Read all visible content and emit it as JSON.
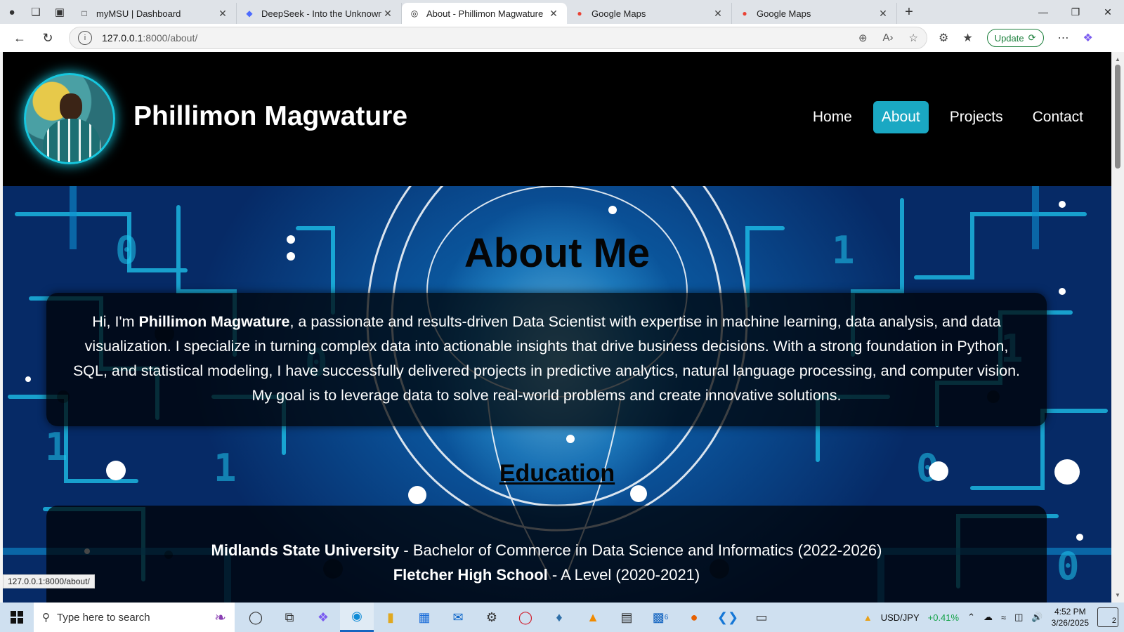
{
  "browser": {
    "tabs": [
      {
        "title": "myMSU | Dashboard",
        "icon": "page-icon",
        "active": false
      },
      {
        "title": "DeepSeek - Into the Unknown",
        "icon": "deepseek-icon",
        "active": false
      },
      {
        "title": "About - Phillimon Magwature",
        "icon": "globe-icon",
        "active": true
      },
      {
        "title": "Google Maps",
        "icon": "maps-pin-icon",
        "active": false
      },
      {
        "title": "Google Maps",
        "icon": "maps-pin-icon",
        "active": false
      }
    ],
    "address_host": "127.0.0.1",
    "address_path": ":8000/about/",
    "update_label": "Update",
    "status_url": "127.0.0.1:8000/about/"
  },
  "site": {
    "title": "Phillimon Magwature",
    "nav": [
      {
        "label": "Home",
        "active": false
      },
      {
        "label": "About",
        "active": true
      },
      {
        "label": "Projects",
        "active": false
      },
      {
        "label": "Contact",
        "active": false
      }
    ],
    "accent_color": "#1aa8c3"
  },
  "about": {
    "heading": "About Me",
    "intro_prefix": "Hi, I'm ",
    "name": "Phillimon Magwature",
    "intro_text": ", a passionate and results-driven Data Scientist with expertise in machine learning, data analysis, and data visualization. I specialize in turning complex data into actionable insights that drive business decisions. With a strong foundation in Python, SQL, and statistical modeling, I have successfully delivered projects in predictive analytics, natural language processing, and computer vision. My goal is to leverage data to solve real-world problems and create innovative solutions."
  },
  "education": {
    "heading": "Education",
    "items": [
      {
        "school": "Midlands State University",
        "detail": " - Bachelor of Commerce in Data Science and Informatics (2022-2026)"
      },
      {
        "school": "Fletcher High School",
        "detail": " - A Level (2020-2021)"
      }
    ]
  },
  "taskbar": {
    "search_placeholder": "Type here to search",
    "ticker_symbol": "USD/JPY",
    "ticker_change": "+0.41%",
    "time": "4:52 PM",
    "date": "3/26/2025",
    "notification_count": "2",
    "badge_count": "6"
  }
}
